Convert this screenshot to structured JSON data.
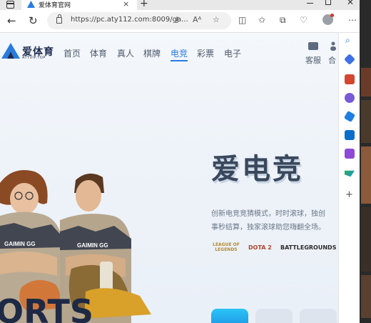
{
  "browser": {
    "tab_title": "爱体育官网",
    "url": "https://pc.aty112.com:8009/ga..."
  },
  "site": {
    "logo_name": "爱体育",
    "logo_sub": "ATYVIP.TOP",
    "nav": [
      "首页",
      "体育",
      "真人",
      "棋牌",
      "电竞",
      "彩票",
      "电子"
    ],
    "active_nav": "电竞",
    "kefu": "客服",
    "he_label": "合"
  },
  "hero": {
    "title": "爱电竞",
    "desc_line1": "创新电竞竞猜模式，时时滚球，独创",
    "desc_line2": "事秒结算，独家滚球助您嗨翻全场。",
    "games": [
      "LEAGUE OF LEGENDS",
      "DOTA 2",
      "BATTLEGROUNDS"
    ],
    "player_jersey": "GAIMIN GG"
  },
  "colors": {
    "accent": "#2a7be0",
    "title": "#39485d",
    "nav_text": "#4d5a6b"
  }
}
